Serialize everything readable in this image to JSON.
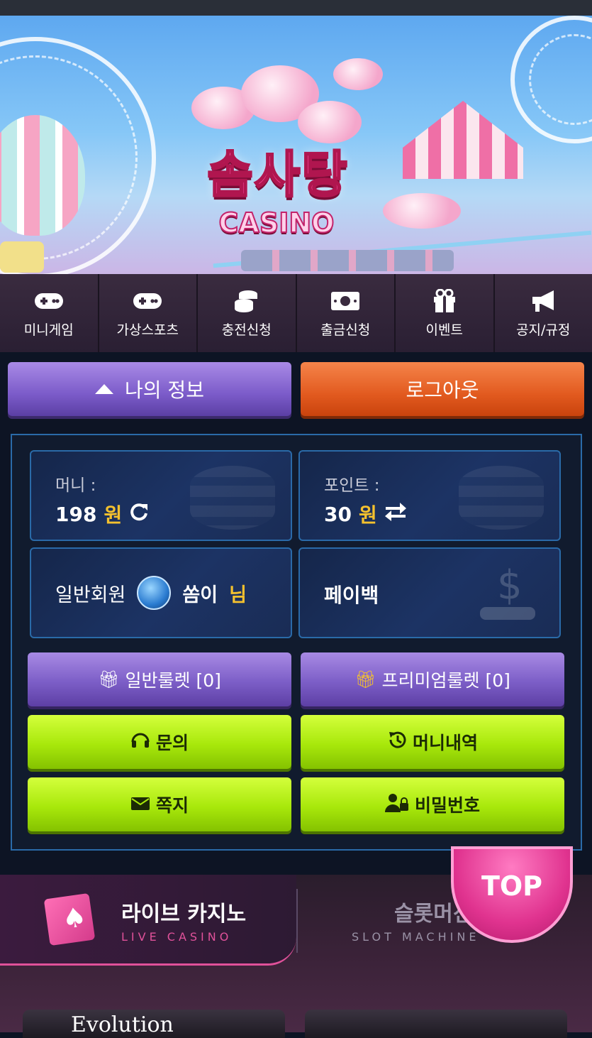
{
  "banner": {
    "logo_korean": "솜사탕",
    "logo_english": "CASINO"
  },
  "nav": {
    "items": [
      {
        "label": "미니게임",
        "icon": "gamepad-icon"
      },
      {
        "label": "가상스포츠",
        "icon": "gamepad-icon"
      },
      {
        "label": "충전신청",
        "icon": "coins-icon"
      },
      {
        "label": "출금신청",
        "icon": "money-bill-icon"
      },
      {
        "label": "이벤트",
        "icon": "gift-icon"
      },
      {
        "label": "공지/규정",
        "icon": "megaphone-icon"
      }
    ]
  },
  "account": {
    "my_info_label": "나의 정보",
    "logout_label": "로그아웃",
    "money_label": "머니 :",
    "money_value": "198",
    "money_unit": "원",
    "point_label": "포인트 :",
    "point_value": "30",
    "point_unit": "원",
    "member_grade": "일반회원",
    "nickname": "쏨이",
    "honorific": "님",
    "payback_label": "페이백"
  },
  "actions": {
    "roulette_normal": "일반룰렛 [0]",
    "roulette_premium": "프리미엄룰렛 [0]",
    "inquiry": "문의",
    "money_history": "머니내역",
    "message": "쪽지",
    "password": "비밀번호"
  },
  "categories": {
    "live_title": "라이브 카지노",
    "live_sub": "LIVE CASINO",
    "slot_title": "슬롯머신",
    "slot_sub": "SLOT MACHINE"
  },
  "top_button": "TOP",
  "game_provider": "Evolution",
  "colors": {
    "accent_gold": "#f4c12e",
    "purple": "#7b5bc9",
    "orange": "#e25a1f",
    "lime": "#a8e80b",
    "panel_border": "#2a6aa8",
    "pink": "#e0519a"
  }
}
